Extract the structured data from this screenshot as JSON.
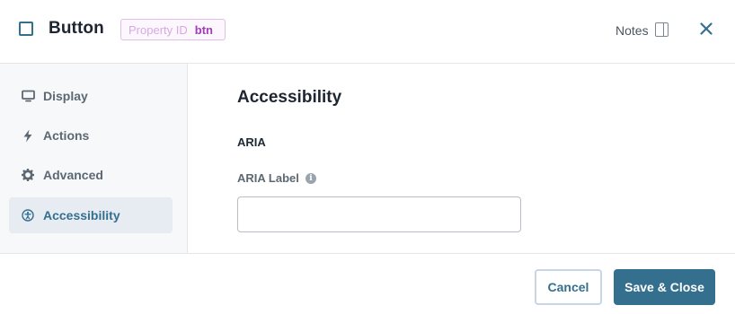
{
  "header": {
    "title": "Button",
    "property_id_label": "Property ID",
    "property_id_value": "btn",
    "notes_label": "Notes"
  },
  "sidebar": {
    "items": [
      {
        "label": "Display",
        "icon": "monitor-icon"
      },
      {
        "label": "Actions",
        "icon": "lightning-bolt-icon"
      },
      {
        "label": "Advanced",
        "icon": "gear-icon"
      },
      {
        "label": "Accessibility",
        "icon": "accessibility-icon",
        "active": true
      }
    ]
  },
  "main": {
    "section_title": "Accessibility",
    "group_title": "ARIA",
    "aria_label": {
      "label": "ARIA Label",
      "value": "",
      "placeholder": ""
    }
  },
  "footer": {
    "cancel_label": "Cancel",
    "save_label": "Save & Close"
  },
  "colors": {
    "accent": "#356f8e",
    "badge_value": "#a13bb8",
    "badge_label": "#d8a8e4",
    "sidebar_bg": "#f6f8f9",
    "active_item_bg": "#e6ecf2"
  }
}
